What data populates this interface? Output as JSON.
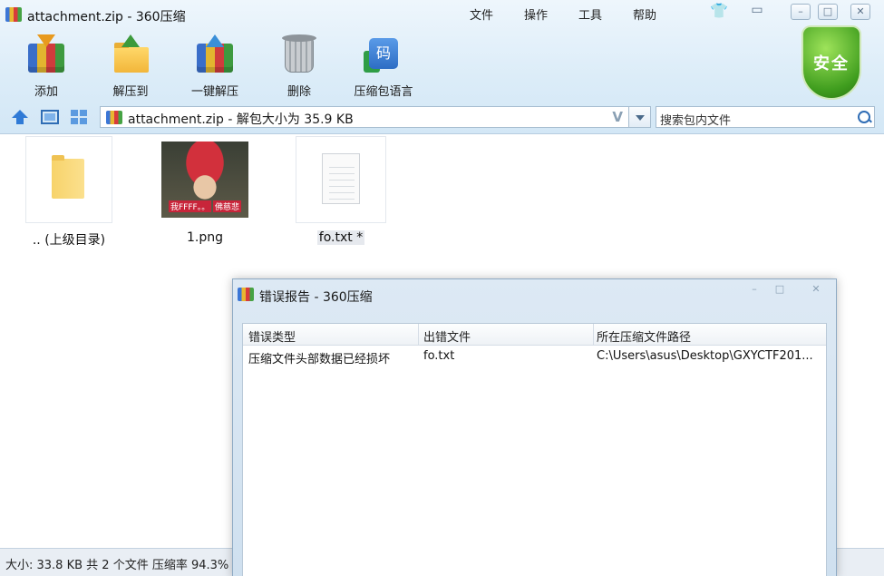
{
  "window": {
    "title": "attachment.zip - 360压缩",
    "menus": [
      "文件",
      "操作",
      "工具",
      "帮助"
    ]
  },
  "toolbar": {
    "add": "添加",
    "extract_to": "解压到",
    "one_click_extract": "一键解压",
    "delete": "删除",
    "package_language": "压缩包语言"
  },
  "badge": {
    "safe_label": "安全"
  },
  "address": {
    "path": "attachment.zip - 解包大小为 35.9 KB",
    "search_placeholder": "搜索包内文件"
  },
  "files": [
    {
      "name": ".. (上级目录)",
      "kind": "folder"
    },
    {
      "name": "1.png",
      "kind": "image",
      "caption_left": "我FFFF。。",
      "caption_right": "佛慈悲"
    },
    {
      "name": "fo.txt *",
      "kind": "text",
      "selected": true
    }
  ],
  "status": {
    "text": "大小: 33.8 KB 共 2 个文件 压缩率 94.3%"
  },
  "error_dialog": {
    "title": "错误报告 - 360压缩",
    "columns": [
      "错误类型",
      "出错文件",
      "所在压缩文件路径"
    ],
    "rows": [
      {
        "type": "压缩文件头部数据已经损坏",
        "file": "fo.txt",
        "path": "C:\\Users\\asus\\Desktop\\GXYCTF201..."
      }
    ]
  },
  "icons": {
    "app": "360zip-icon",
    "up": "up-arrow-icon",
    "view_large": "large-icon-view-icon",
    "view_grid": "grid-view-icon",
    "search": "search-icon",
    "skin": "skin-icon",
    "feedback": "feedback-icon"
  }
}
